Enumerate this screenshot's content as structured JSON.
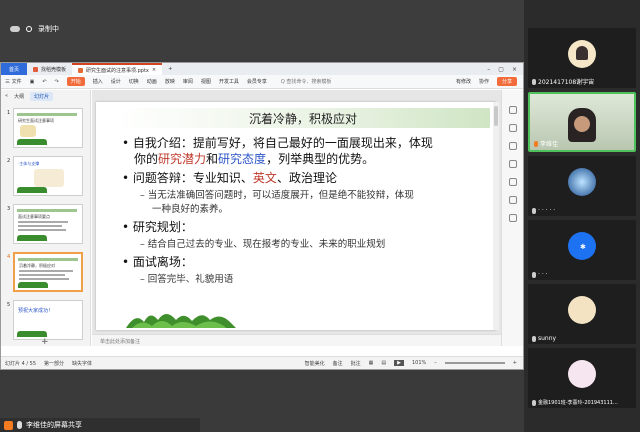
{
  "meeting": {
    "recording_label": "录制中",
    "share_label": "李维佳的屏幕共享"
  },
  "wps": {
    "tabs": [
      {
        "label": "首页"
      },
      {
        "label": "找稻壳模板"
      },
      {
        "label": "研究生面试的注意事项.pptx"
      }
    ],
    "add_tab": "+",
    "menu": {
      "file": "三 文件",
      "start": "开始",
      "items": [
        "插入",
        "设计",
        "切换",
        "动画",
        "放映",
        "审阅",
        "视图",
        "开发工具",
        "会员专享"
      ],
      "search": "Q 查找命令、搜索模板",
      "collab": "有修改",
      "cooperate": "协作",
      "share": "分享"
    },
    "panel": {
      "outline": "大纲",
      "slides": "幻灯片"
    },
    "thumbnails": [
      {
        "num": "1",
        "text": "研究生面试注意事项"
      },
      {
        "num": "2",
        "text": "·主体与支撑"
      },
      {
        "num": "3",
        "text": "面试注意事项要点"
      },
      {
        "num": "4",
        "text": "沉着冷静，积极应对"
      },
      {
        "num": "5",
        "text": "预祝大家成功！"
      }
    ],
    "add_slide": "+",
    "slide": {
      "title": "沉着冷静，积极应对",
      "b1_a": "自我介绍：提前写好，将自己最好的一面展现出来，体现",
      "b1_b_pre": "你的",
      "b1_b_red": "研究潜力",
      "b1_b_mid": "和",
      "b1_b_blue": "研究态度",
      "b1_b_post": "，列举典型的优势。",
      "b2_pre": "问题答辩：专业知识、",
      "b2_red": "英文",
      "b2_post": "、政治理论",
      "b2_sub1": "– 当无法准确回答问题时，可以适度展开，但是绝不能狡辩，体现",
      "b2_sub2": "一种良好的素养。",
      "b3": "研究规划：",
      "b3_sub": "– 结合自己过去的专业、现在报考的专业、未来的职业规划",
      "b4": "面试离场：",
      "b4_sub": "– 回答完毕、礼貌用语"
    },
    "notes_placeholder": "单击此处添加备注",
    "status": {
      "slide_info": "幻灯片 4 / 55",
      "theme": "第一部分",
      "font": "缺失字体",
      "smart": "智能美化",
      "notes": "备注",
      "comments": "批注",
      "zoom": "101%"
    }
  },
  "participants": [
    {
      "name": "2021417108谢宇宙",
      "avatar_color": "#f5e7c8"
    },
    {
      "name": "李维佳",
      "avatar_color": "#c79a7c"
    },
    {
      "name": "· · · · ·",
      "avatar_color": "#1a4d8f"
    },
    {
      "name": "· · ·",
      "avatar_color": "#1d72f2"
    },
    {
      "name": "sunny",
      "avatar_color": "#f3e3c3"
    },
    {
      "name": "金融1901班-李薏玲-201943111...",
      "avatar_color": "#f6e6f0"
    }
  ]
}
